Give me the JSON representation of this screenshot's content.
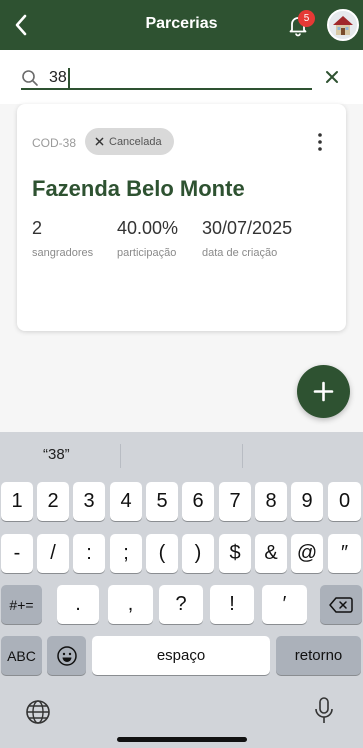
{
  "header": {
    "title": "Parcerias",
    "notification_count": "5",
    "icons": [
      "back-arrow-icon",
      "bell-icon",
      "profile-avatar-icon"
    ]
  },
  "search": {
    "value": "38"
  },
  "card": {
    "code": "COD-38",
    "status": "Cancelada",
    "name": "Fazenda Belo Monte",
    "stats": [
      {
        "value": "2",
        "label": "sangradores"
      },
      {
        "value": "40.00%",
        "label": "participação"
      },
      {
        "value": "30/07/2025",
        "label": "data de criação"
      }
    ]
  },
  "keyboard": {
    "suggestion": "“38”",
    "row1": [
      "1",
      "2",
      "3",
      "4",
      "5",
      "6",
      "7",
      "8",
      "9",
      "0"
    ],
    "row2": [
      "-",
      "/",
      ":",
      ";",
      "(",
      ")",
      "$",
      "&",
      "@",
      "″"
    ],
    "row3_left": "#+=",
    "row3": [
      ".",
      ",",
      "?",
      "!",
      "′"
    ],
    "abc": "ABC",
    "space": "espaço",
    "return": "retorno"
  },
  "colors": {
    "primary": "#2e5231",
    "badge": "#e53935",
    "status_pill": "#d9d9d9",
    "keyboard_bg": "#d1d4d9"
  }
}
